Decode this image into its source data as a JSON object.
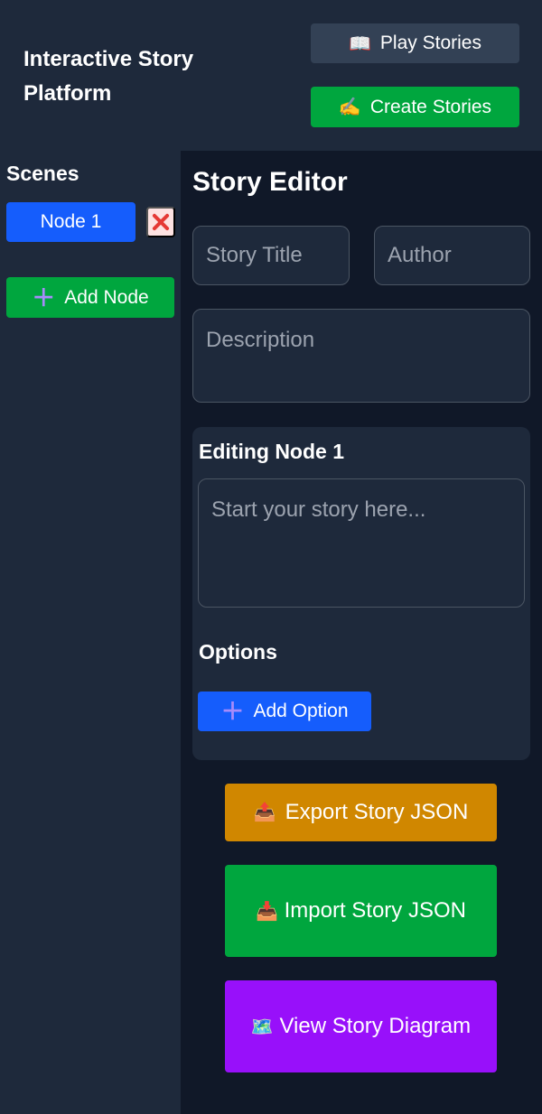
{
  "header": {
    "title": "Interactive Story Platform",
    "play_label": "Play Stories",
    "create_label": "Create Stories"
  },
  "sidebar": {
    "heading": "Scenes",
    "nodes": [
      {
        "label": "Node 1"
      }
    ],
    "add_node_label": "Add Node"
  },
  "editor": {
    "title": "Story Editor",
    "story_title_placeholder": "Story Title",
    "author_placeholder": "Author",
    "description_placeholder": "Description",
    "node_heading": "Editing Node 1",
    "story_placeholder": "Start your story here...",
    "options_heading": "Options",
    "add_option_label": "Add Option"
  },
  "actions": {
    "export_label": "Export Story JSON",
    "import_label": "Import Story JSON",
    "diagram_label": "View Story Diagram"
  },
  "icons": {
    "play": "book-icon",
    "create": "writing-hand-icon",
    "delete": "cross-mark-icon",
    "add": "plus-icon",
    "export": "outbox-tray-icon",
    "import": "inbox-tray-icon",
    "diagram": "map-icon"
  },
  "colors": {
    "background": "#1e293b",
    "main_bg": "#101828",
    "blue": "#155dfc",
    "green": "#00a63e",
    "orange": "#d08700",
    "purple": "#9810fa"
  }
}
